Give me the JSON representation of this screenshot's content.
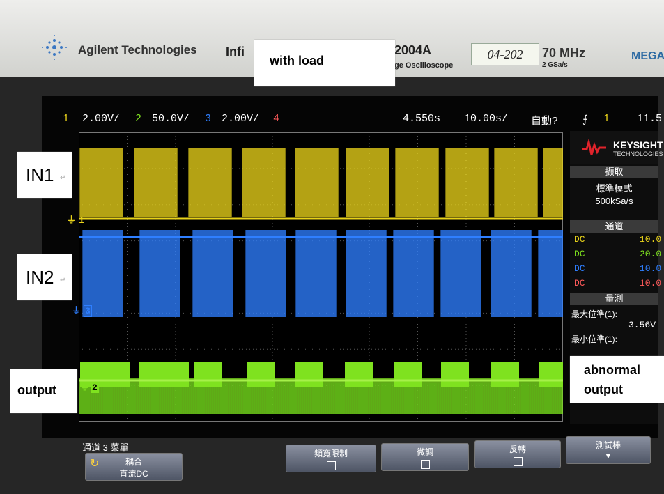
{
  "panel": {
    "brand": "Agilent Technologies",
    "model_left": "Infi",
    "model_right": "2004A",
    "subtitle": "ge Oscilloscope",
    "asset_tag": "04-202",
    "bandwidth": "70 MHz",
    "sample_rate": "2 GSa/s",
    "mega": "MEGA"
  },
  "overlay": {
    "with_load": "with load",
    "in1": "IN1",
    "in2": "IN2",
    "output": "output",
    "abnormal": "abnormal\noutput",
    "return_mark": "↵"
  },
  "status": {
    "ch1_num": "1",
    "ch1_scale": "2.00V/",
    "ch2_num": "2",
    "ch2_scale": "50.0V/",
    "ch3_num": "3",
    "ch3_scale": "2.00V/",
    "ch4_num": "4",
    "delay": "4.550s",
    "timebase": "10.00s/",
    "trigger_mode": "自動?",
    "trigger_icon": "⨍",
    "trigger_src": "1",
    "trigger_level": "11.5"
  },
  "colors": {
    "ch1": "#e8d21a",
    "ch2": "#7fe21f",
    "ch3": "#2f7fff",
    "ch4": "#ff5a5a"
  },
  "markers": {
    "ch1": "1",
    "ch3": "3",
    "ch2": "2"
  },
  "sidebar": {
    "logo": "KEYSIGHT",
    "logo_sub": "TECHNOLOGIES",
    "acq_title": "擷取",
    "acq_mode": "標準模式",
    "acq_rate": "500kSa/s",
    "chan_title": "通道",
    "channels": [
      {
        "coupling": "DC",
        "value": "10.0"
      },
      {
        "coupling": "DC",
        "value": "20.0"
      },
      {
        "coupling": "DC",
        "value": "10.0"
      },
      {
        "coupling": "DC",
        "value": "10.0"
      }
    ],
    "meas_title": "量測",
    "meas1_label": "最大位準(1):",
    "meas1_value": "3.56V",
    "meas2_label": "最小位準(1):"
  },
  "softkeys": {
    "menu_title": "通道 3 菜單",
    "coupling_label": "耦合",
    "coupling_value": "直流DC",
    "bw_limit": "頻寬限制",
    "fine": "微調",
    "invert": "反轉",
    "probe": "測試棒"
  }
}
